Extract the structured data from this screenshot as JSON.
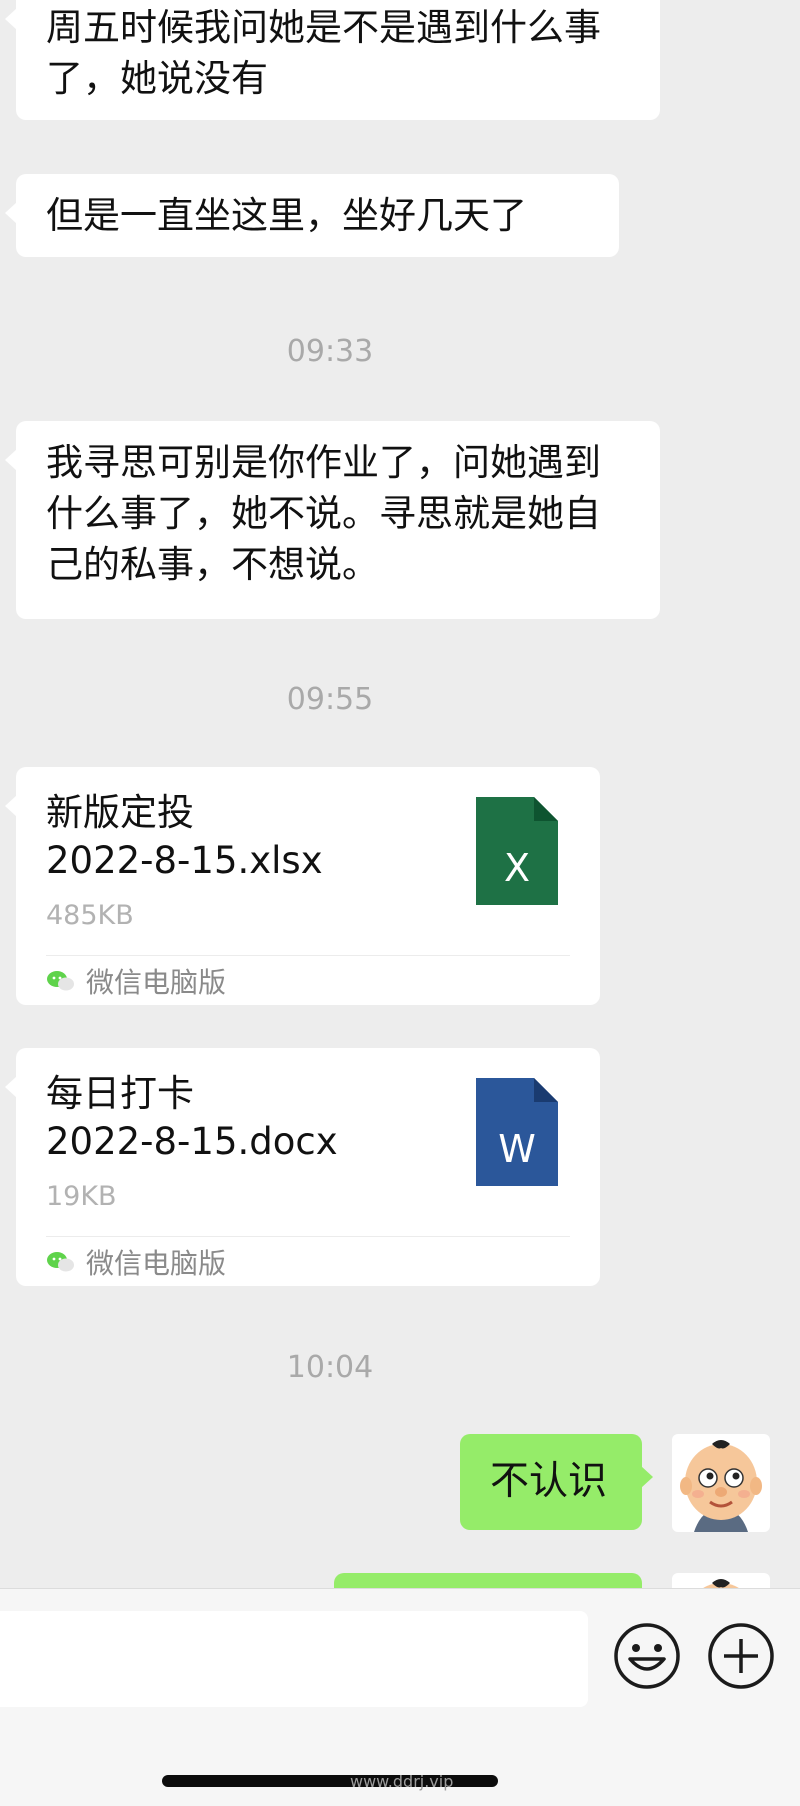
{
  "messages": {
    "m1": "周五时候我问她是不是遇到什么事了，她说没有",
    "m2": "但是一直坐这里，坐好几天了",
    "t1": "09:33",
    "m3": "我寻思可别是你作业了，问她遇到什么事了，她不说。寻思就是她自己的私事，不想说。",
    "t2": "09:55",
    "file1": {
      "name_line1": "新版定投",
      "name_line2": "2022-8-15.xlsx",
      "size": "485KB",
      "icon_letter": "X",
      "icon_color": "#1e7145",
      "source": "微信电脑版"
    },
    "file2": {
      "name_line1": "每日打卡",
      "name_line2": "2022-8-15.docx",
      "size": "19KB",
      "icon_letter": "W",
      "icon_color": "#2b579a",
      "source": "微信电脑版"
    },
    "t3": "10:04",
    "m4": "不认识"
  },
  "input": {
    "placeholder": ""
  },
  "icons": {
    "emoji": "emoji-icon",
    "plus": "plus-icon",
    "wechat": "wechat-icon"
  },
  "colors": {
    "background": "#ededed",
    "incoming_bubble": "#ffffff",
    "outgoing_bubble": "#95ec69",
    "timestamp": "#a9a9a9"
  },
  "watermark": "www.ddrj.vip"
}
